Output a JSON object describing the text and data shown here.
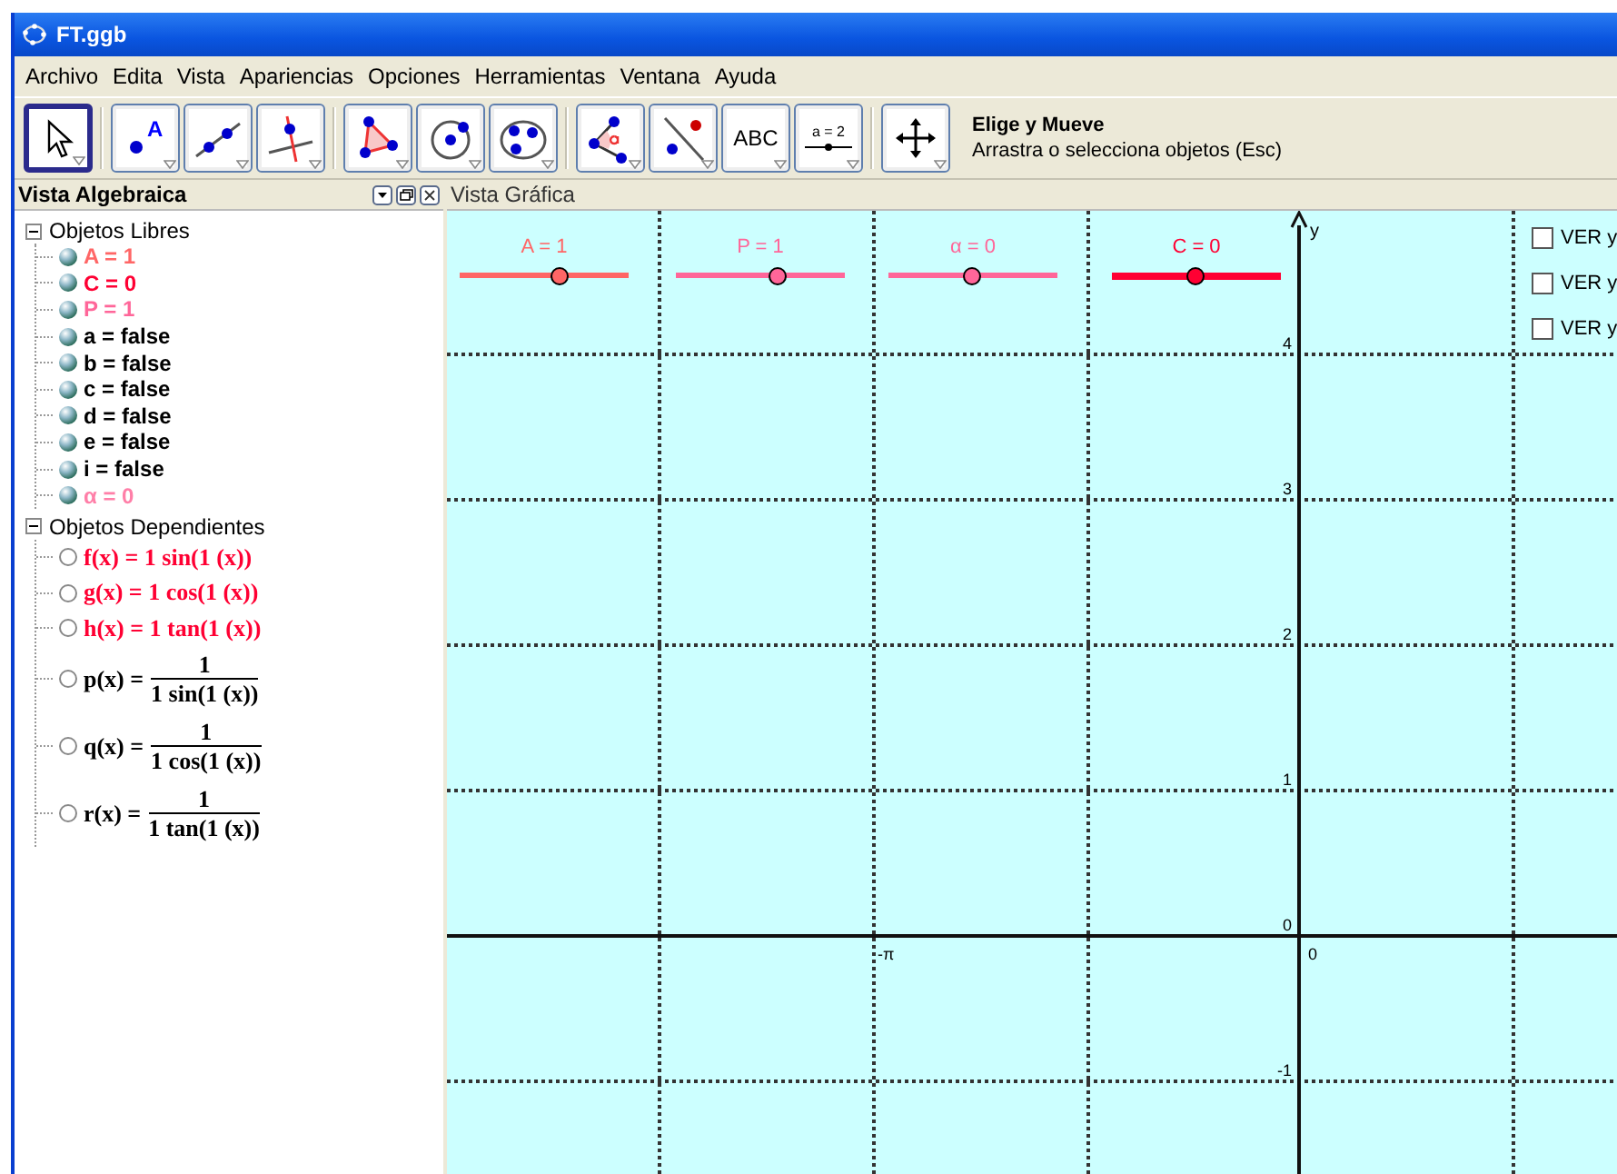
{
  "window": {
    "title": "FT.ggb"
  },
  "menu": [
    "Archivo",
    "Edita",
    "Vista",
    "Apariencias",
    "Opciones",
    "Herramientas",
    "Ventana",
    "Ayuda"
  ],
  "tool_groups": [
    [
      {
        "selected": true
      }
    ],
    [
      {
        "label": "A",
        "selected": false
      },
      {
        "selected": false
      },
      {
        "selected": false
      }
    ],
    [
      {
        "selected": false
      },
      {
        "selected": false
      },
      {
        "selected": false
      }
    ],
    [
      {
        "selected": false
      },
      {
        "selected": false
      },
      {
        "label": "ABC",
        "selected": false
      },
      {
        "label": "a = 2",
        "selected": false
      }
    ],
    [
      {
        "selected": false
      }
    ]
  ],
  "tool_help": {
    "title": "Elige y Mueve",
    "description": "Arrastra o selecciona objetos (Esc)"
  },
  "algebra_view": {
    "title": "Vista Algebraica",
    "folders": [
      {
        "label": "Objetos Libres",
        "expanded": true,
        "children": [
          {
            "kind": "text",
            "text": "A = 1",
            "color": "#ff6666",
            "visible": true
          },
          {
            "kind": "text",
            "text": "C = 0",
            "color": "#ff0033",
            "visible": true
          },
          {
            "kind": "text",
            "text": "P = 1",
            "color": "#ff6699",
            "visible": true
          },
          {
            "kind": "text",
            "text": "a = false",
            "color": "#000000",
            "visible": true
          },
          {
            "kind": "text",
            "text": "b = false",
            "color": "#000000",
            "visible": true
          },
          {
            "kind": "text",
            "text": "c = false",
            "color": "#000000",
            "visible": true
          },
          {
            "kind": "text",
            "text": "d = false",
            "color": "#000000",
            "visible": true
          },
          {
            "kind": "text",
            "text": "e = false",
            "color": "#000000",
            "visible": true
          },
          {
            "kind": "text",
            "text": "i = false",
            "color": "#000000",
            "visible": true
          },
          {
            "kind": "text",
            "text": "α = 0",
            "color": "#ff7fa8",
            "visible": true
          }
        ]
      },
      {
        "label": "Objetos Dependientes",
        "expanded": true,
        "children": [
          {
            "kind": "formula",
            "text": "f(x) = 1 sin(1 (x))",
            "color": "#ff0033",
            "visible": false
          },
          {
            "kind": "formula",
            "text": "g(x) = 1 cos(1 (x))",
            "color": "#ff0033",
            "visible": false
          },
          {
            "kind": "formula",
            "text": "h(x) = 1 tan(1 (x))",
            "color": "#ff0033",
            "visible": false
          },
          {
            "kind": "fraction",
            "lhs": "p(x) =",
            "numerator": "1",
            "denominator": "1 sin(1 (x))",
            "color": "#000000",
            "visible": false
          },
          {
            "kind": "fraction",
            "lhs": "q(x) =",
            "numerator": "1",
            "denominator": "1 cos(1 (x))",
            "color": "#000000",
            "visible": false
          },
          {
            "kind": "fraction",
            "lhs": "r(x) =",
            "numerator": "1",
            "denominator": "1 tan(1 (x))",
            "color": "#000000",
            "visible": false
          }
        ]
      }
    ]
  },
  "graphics_view": {
    "title": "Vista Gráfica",
    "sliders": [
      {
        "label": "A = 1",
        "color": "#ff6666",
        "level": 0.59
      },
      {
        "label": "P = 1",
        "color": "#ff6699",
        "level": 0.6
      },
      {
        "label": "α = 0",
        "color": "#ff6699",
        "level": 0.49
      },
      {
        "label": "C = 0",
        "color": "#ff0033",
        "level": 0.49
      }
    ],
    "checkboxes": [
      {
        "label": "VER y",
        "checked": false
      },
      {
        "label": "VER y",
        "checked": false
      },
      {
        "label": "VER y",
        "checked": false
      }
    ],
    "y_axis_label": "y",
    "y_tick_labels": [
      "4",
      "3",
      "2",
      "1",
      "0",
      "-1"
    ],
    "x_tick_labels": [
      "-π",
      "0"
    ]
  }
}
